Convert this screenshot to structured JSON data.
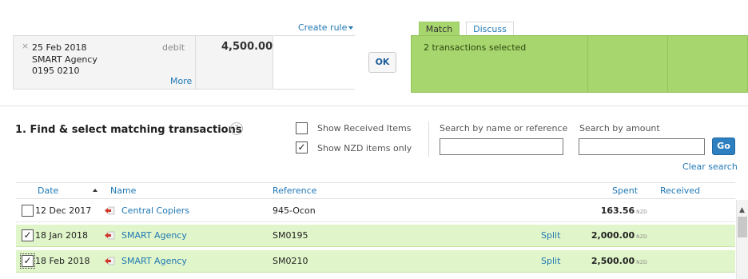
{
  "statement": {
    "close_glyph": "×",
    "date": "25 Feb 2018",
    "name": "SMART Agency",
    "reference": "0195 0210",
    "type": "debit",
    "amount": "4,500.00",
    "more_link": "More"
  },
  "create_rule": {
    "label": "Create rule"
  },
  "ok_button": {
    "label": "OK"
  },
  "match": {
    "tabs": [
      {
        "label": "Match",
        "active": true
      },
      {
        "label": "Discuss",
        "active": false
      }
    ],
    "status": "2 transactions selected"
  },
  "find": {
    "title": "1. Find & select matching transactions",
    "help_glyph": "?",
    "show_received": {
      "label": "Show Received Items",
      "checked": false
    },
    "show_nzd": {
      "label": "Show NZD items only",
      "checked": true
    },
    "search_name": {
      "label": "Search by name or reference",
      "value": ""
    },
    "search_amount": {
      "label": "Search by amount",
      "value": ""
    },
    "go_label": "Go",
    "clear_label": "Clear search"
  },
  "table": {
    "headers": {
      "date": "Date",
      "name": "Name",
      "reference": "Reference",
      "spent": "Spent",
      "received": "Received"
    },
    "rows": [
      {
        "checked": false,
        "check_glyph": "",
        "date": "12 Dec 2017",
        "name": "Central Copiers",
        "reference": "945-Ocon",
        "split": "",
        "spent": "163.56",
        "currency": "NZD",
        "received": ""
      },
      {
        "checked": true,
        "check_glyph": "✓",
        "date": "18 Jan 2018",
        "name": "SMART Agency",
        "reference": "SM0195",
        "split": "Split",
        "spent": "2,000.00",
        "currency": "NZD",
        "received": ""
      },
      {
        "checked": true,
        "check_glyph": "✓",
        "date": "18 Feb 2018",
        "name": "SMART Agency",
        "reference": "SM0210",
        "split": "Split",
        "spent": "2,500.00",
        "currency": "NZD",
        "received": ""
      }
    ]
  },
  "colors": {
    "match_green": "#a8d66e",
    "selected_row": "#e0f5c9",
    "link_blue": "#1f77b4",
    "go_blue": "#2d7fc0",
    "icon_red": "#d0382b"
  },
  "icons": {
    "spend_money": "spend-money-icon"
  }
}
